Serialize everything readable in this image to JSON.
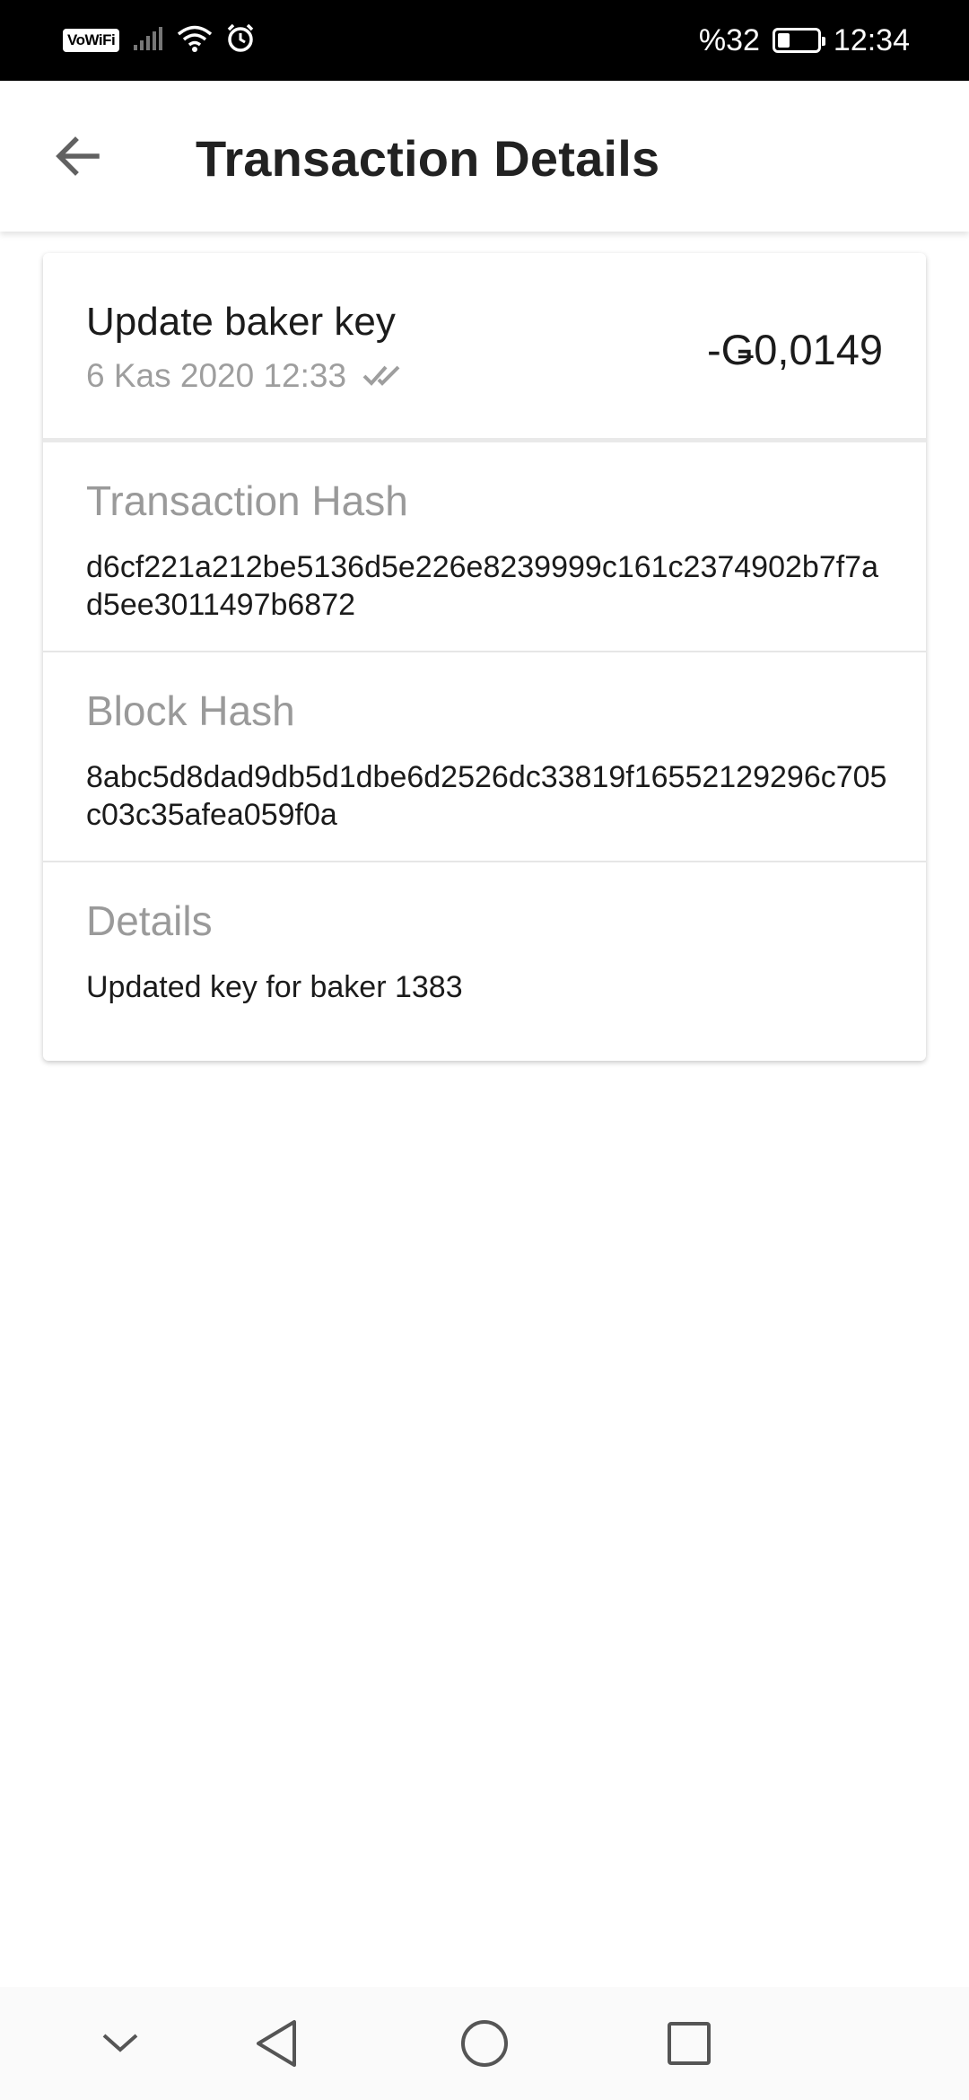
{
  "status_bar": {
    "vowifi_label": "VoWiFi",
    "battery_text": "%32",
    "battery_level": 0.32,
    "time": "12:34",
    "icons": [
      "signal-icon",
      "wifi-icon",
      "alarm-icon",
      "battery-icon"
    ]
  },
  "app_bar": {
    "title": "Transaction Details",
    "back_icon": "arrow-left-icon"
  },
  "transaction": {
    "title": "Update baker key",
    "date": "6 Kas 2020 12:33",
    "status_icon": "double-check-icon",
    "amount": "-Ǥ0,0149"
  },
  "sections": {
    "transaction_hash": {
      "label": "Transaction Hash",
      "value": "d6cf221a212be5136d5e226e8239999c161c2374902b7f7ad5ee3011497b6872"
    },
    "block_hash": {
      "label": "Block Hash",
      "value": "8abc5d8dad9db5d1dbe6d2526dc33819f16552129296c705c03c35afea059f0a"
    },
    "details": {
      "label": "Details",
      "value": "Updated key for baker 1383"
    }
  },
  "nav_bar": {
    "buttons": [
      "chevron-down-icon",
      "back-triangle-icon",
      "home-circle-icon",
      "recents-square-icon"
    ]
  },
  "colors": {
    "status_bar_bg": "#000000",
    "text_primary": "#1b1b1b",
    "text_secondary": "#9e9e9e",
    "divider": "#e6e6e6"
  }
}
